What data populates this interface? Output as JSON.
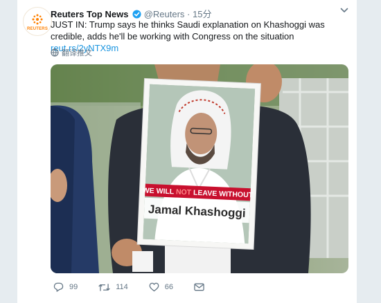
{
  "tweet": {
    "account_name": "Reuters Top News",
    "handle": "@Reuters",
    "separator": "·",
    "time": "15分",
    "avatar_label": "REUTERS",
    "text_prefix": "JUST IN: Trump says he thinks Saudi explanation on Khashoggi was credible, adds he'll be working with Congress on the situation ",
    "link_text": "reut.rs/2yNTX9m",
    "translate_label": "翻译推文"
  },
  "media": {
    "sign_line1_a": "WE WILL ",
    "sign_line1_b": "NOT",
    "sign_line1_c": " LEAVE WITHOUT",
    "sign_line2": "Jamal Khashoggi"
  },
  "actions": {
    "reply_count": "99",
    "retweet_count": "114",
    "like_count": "66"
  },
  "colors": {
    "link": "#1b95e0",
    "verified": "#1da1f2",
    "brand": "#ff8000",
    "sign_red": "#c8102e"
  }
}
